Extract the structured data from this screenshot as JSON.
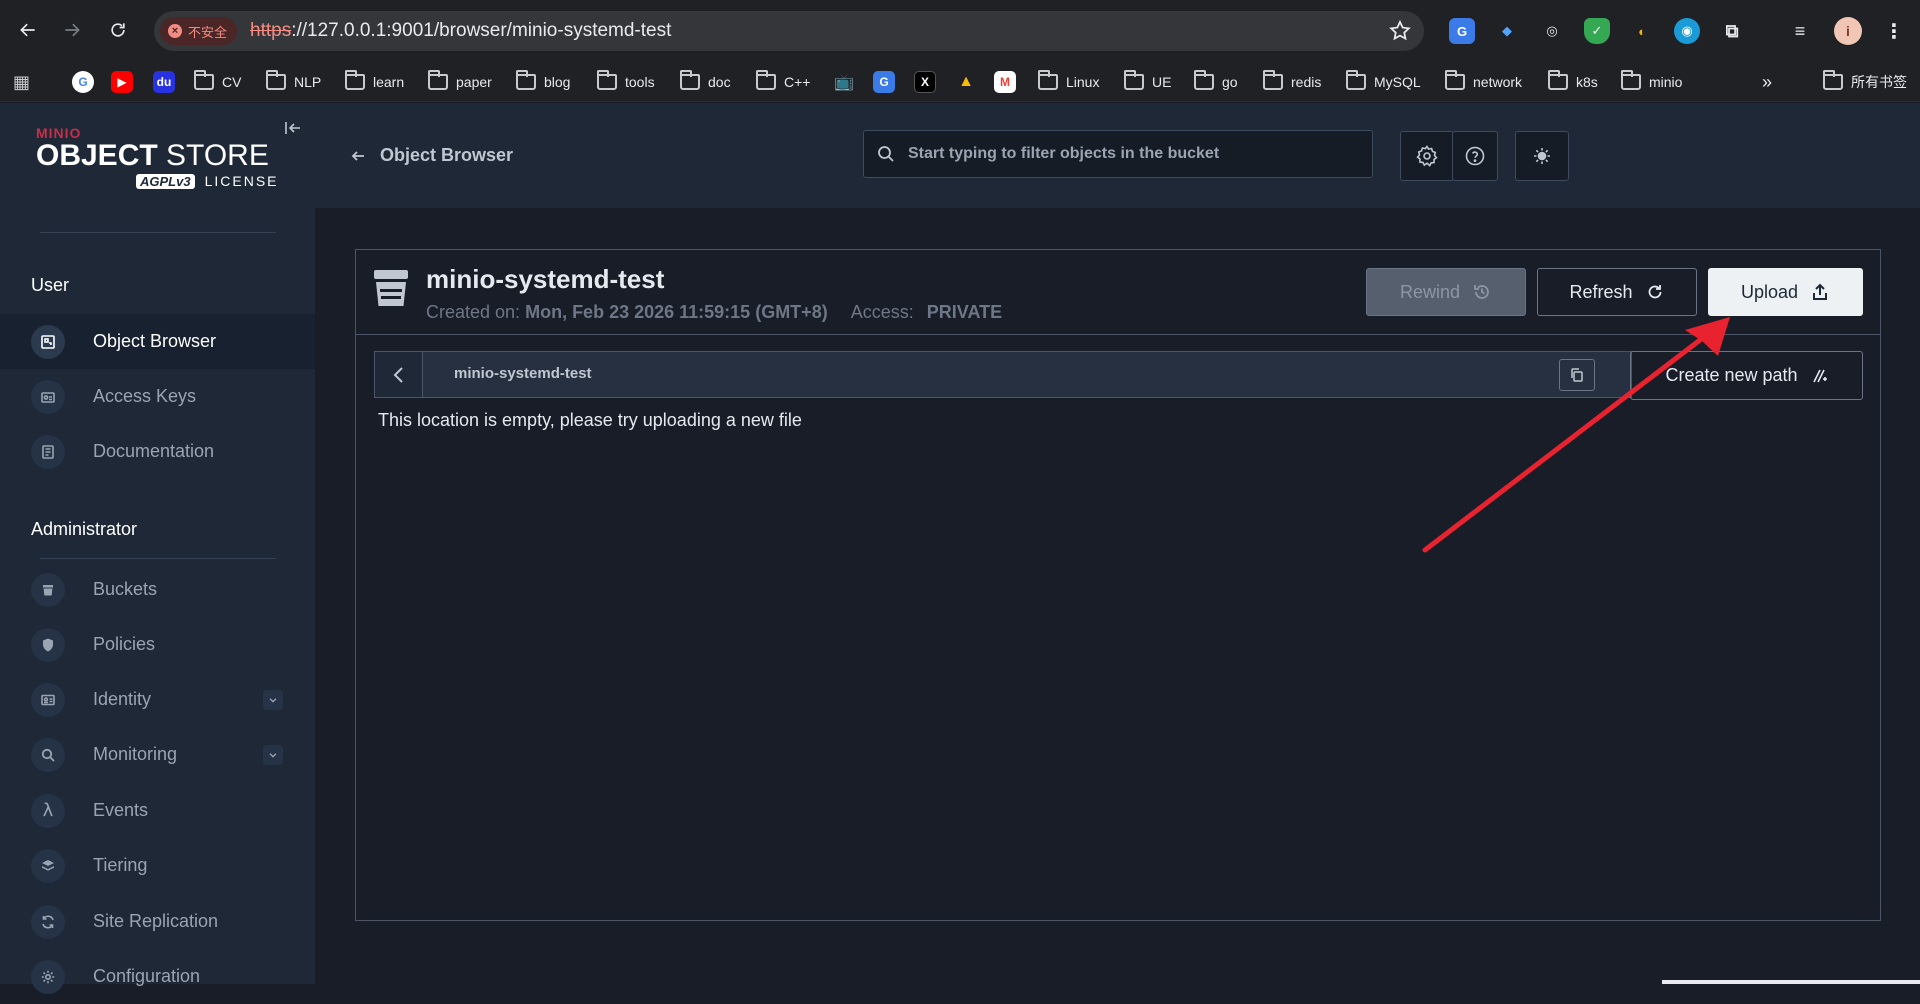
{
  "browser": {
    "security_label": "不安全",
    "url_scheme": "https",
    "url_rest": "://127.0.0.1:9001/browser/minio-systemd-test",
    "bookmarks": [
      "CV",
      "NLP",
      "learn",
      "paper",
      "blog",
      "tools",
      "doc",
      "C++",
      "Linux",
      "UE",
      "go",
      "redis",
      "MySQL",
      "network",
      "k8s",
      "minio"
    ],
    "other_bookmarks": "所有书签"
  },
  "sidebar": {
    "logo_brand": "MINIO",
    "logo_title_bold": "OBJECT",
    "logo_title_rest": " STORE",
    "logo_badge": "AGPLv3",
    "logo_license": "LICENSE",
    "sections": {
      "user": "User",
      "admin": "Administrator"
    },
    "user_items": [
      "Object Browser",
      "Access Keys",
      "Documentation"
    ],
    "admin_items": [
      "Buckets",
      "Policies",
      "Identity",
      "Monitoring",
      "Events",
      "Tiering",
      "Site Replication",
      "Configuration"
    ]
  },
  "header": {
    "back_label": "Object Browser",
    "search_placeholder": "Start typing to filter objects in the bucket"
  },
  "bucket": {
    "name": "minio-systemd-test",
    "created_label": "Created on:",
    "created_value": "Mon, Feb 23 2026 11:59:15 (GMT+8)",
    "access_label": "Access:",
    "access_value": "PRIVATE",
    "rewind_label": "Rewind",
    "refresh_label": "Refresh",
    "upload_label": "Upload",
    "breadcrumb": "minio-systemd-test",
    "create_path_label": "Create new path",
    "empty_message": "This location is empty, please try uploading a new file"
  },
  "colors": {
    "annotation_arrow": "#e8232f",
    "minio_red": "#c72e49"
  }
}
